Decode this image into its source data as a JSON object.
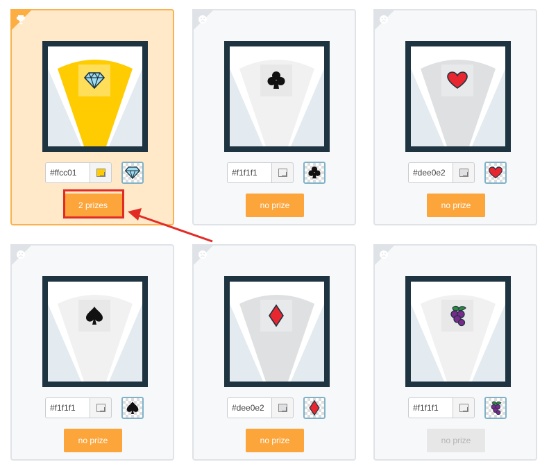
{
  "cards": [
    {
      "id": "diamond",
      "symbol": "diamond-icon",
      "color_value": "#ffcc01",
      "button_label": "2 prizes",
      "winner": true,
      "button_enabled": true,
      "wedge_color": "#ffcc01"
    },
    {
      "id": "club",
      "symbol": "club-icon",
      "color_value": "#f1f1f1",
      "button_label": "no prize",
      "winner": false,
      "button_enabled": true,
      "wedge_color": "#f1f1f1"
    },
    {
      "id": "heart",
      "symbol": "heart-icon",
      "color_value": "#dee0e2",
      "button_label": "no prize",
      "winner": false,
      "button_enabled": true,
      "wedge_color": "#dee0e2"
    },
    {
      "id": "spade",
      "symbol": "spade-icon",
      "color_value": "#f1f1f1",
      "button_label": "no prize",
      "winner": false,
      "button_enabled": true,
      "wedge_color": "#f1f1f1"
    },
    {
      "id": "diamond-card",
      "symbol": "diamond-suit-icon",
      "color_value": "#dee0e2",
      "button_label": "no prize",
      "winner": false,
      "button_enabled": true,
      "wedge_color": "#dee0e2"
    },
    {
      "id": "grapes",
      "symbol": "grapes-icon",
      "color_value": "#f1f1f1",
      "button_label": "no prize",
      "winner": false,
      "button_enabled": false,
      "wedge_color": "#f1f1f1"
    }
  ],
  "colors": {
    "accent": "#fba53b",
    "frame": "#1f3441",
    "highlight": "#e32b26",
    "winner_bg": "#ffe9c9"
  }
}
